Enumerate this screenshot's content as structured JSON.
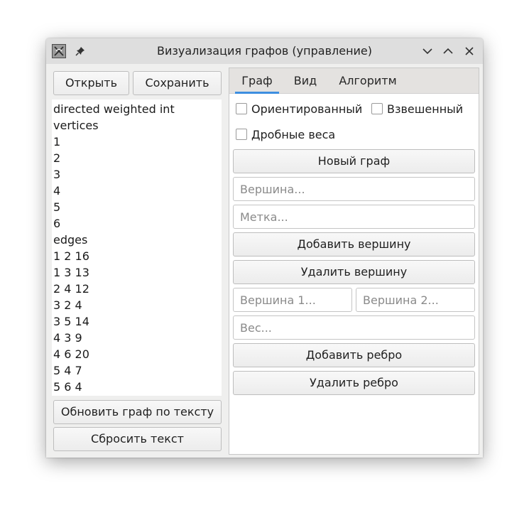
{
  "window": {
    "title": "Визуализация графов (управление)"
  },
  "left": {
    "open_label": "Открыть",
    "save_label": "Сохранить",
    "text_lines": [
      "directed weighted int",
      "vertices",
      "1",
      "2",
      "3",
      "4",
      "5",
      "6",
      "edges",
      "1 2 16",
      "1 3 13",
      "2 4 12",
      "3 2 4",
      "3 5 14",
      "4 3 9",
      "4 6 20",
      "5 4 7",
      "5 6 4"
    ],
    "refresh_label": "Обновить граф по тексту",
    "reset_label": "Сбросить текст"
  },
  "right": {
    "tabs": [
      {
        "label": "Граф",
        "active": true
      },
      {
        "label": "Вид",
        "active": false
      },
      {
        "label": "Алгоритм",
        "active": false
      }
    ],
    "checkboxes": {
      "oriented": {
        "label": "Ориентированный",
        "checked": false
      },
      "weighted": {
        "label": "Взвешенный",
        "checked": false
      },
      "fractional": {
        "label": "Дробные веса",
        "checked": false
      }
    },
    "new_graph_label": "Новый граф",
    "vertex_placeholder": "Вершина...",
    "label_placeholder": "Метка...",
    "add_vertex_label": "Добавить вершину",
    "remove_vertex_label": "Удалить вершину",
    "vertex1_placeholder": "Вершина 1...",
    "vertex2_placeholder": "Вершина 2...",
    "weight_placeholder": "Вес...",
    "add_edge_label": "Добавить ребро",
    "remove_edge_label": "Удалить ребро"
  },
  "colors": {
    "accent": "#3d8ee0",
    "titlebar": "#dedede",
    "window_bg": "#efefee"
  }
}
